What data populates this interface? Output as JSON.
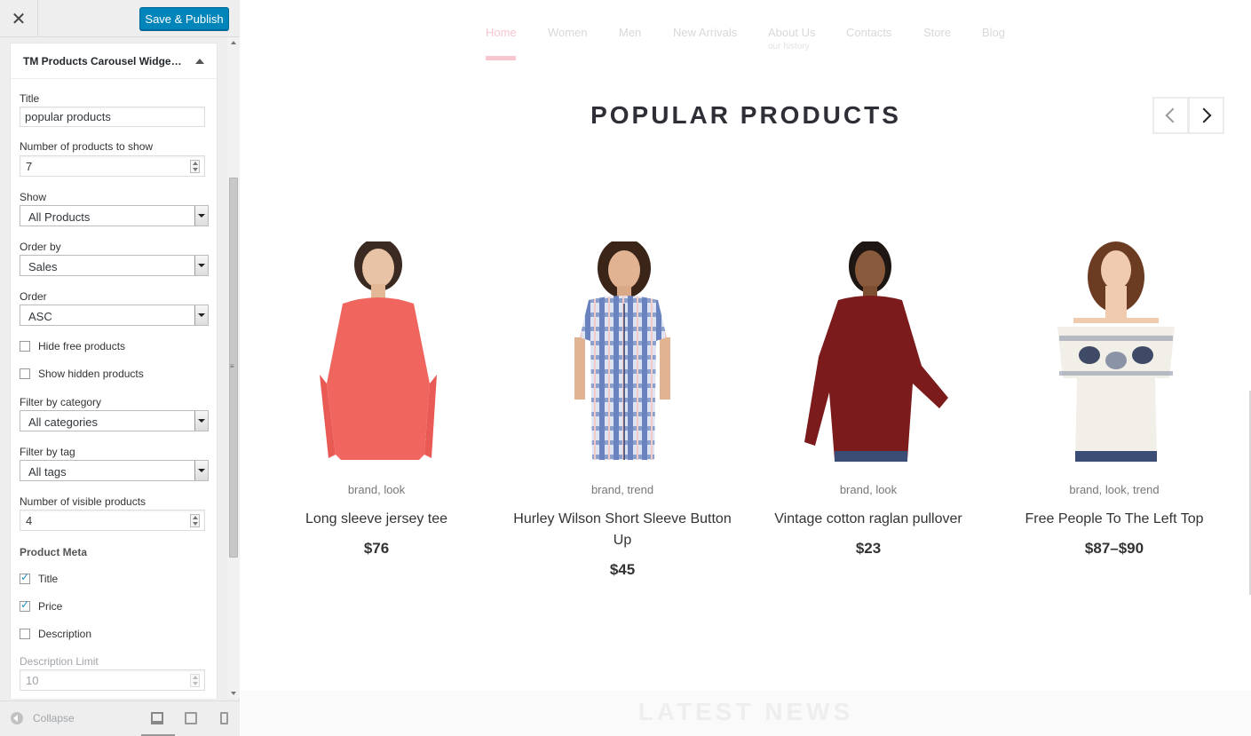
{
  "header": {
    "close_icon": "close-icon",
    "publish_label": "Save & Publish"
  },
  "widget": {
    "title": "TM Products Carousel Widge…",
    "title_label": "Title",
    "title_value": "popular products",
    "num_label": "Number of products to show",
    "num_value": "7",
    "show_label": "Show",
    "show_value": "All Products",
    "orderby_label": "Order by",
    "orderby_value": "Sales",
    "order_label": "Order",
    "order_value": "ASC",
    "hide_free_label": "Hide free products",
    "hide_free_checked": false,
    "show_hidden_label": "Show hidden products",
    "show_hidden_checked": false,
    "cat_label": "Filter by category",
    "cat_value": "All categories",
    "tag_label": "Filter by tag",
    "tag_value": "All tags",
    "visible_label": "Number of visible products",
    "visible_value": "4",
    "meta_label": "Product Meta",
    "meta_title_label": "Title",
    "meta_title_checked": true,
    "meta_price_label": "Price",
    "meta_price_checked": true,
    "meta_desc_label": "Description",
    "meta_desc_checked": false,
    "desc_limit_label": "Description Limit",
    "desc_limit_value": "10"
  },
  "footer": {
    "collapse_label": "Collapse"
  },
  "nav": {
    "items": [
      {
        "label": "Home",
        "active": true
      },
      {
        "label": "Women"
      },
      {
        "label": "Men"
      },
      {
        "label": "New Arrivals"
      },
      {
        "label": "About Us",
        "sub": "our history"
      },
      {
        "label": "Contacts"
      },
      {
        "label": "Store"
      },
      {
        "label": "Blog"
      }
    ]
  },
  "section": {
    "heading": "POPULAR PRODUCTS"
  },
  "products": [
    {
      "tags": [
        "brand",
        "look"
      ],
      "name": "Long sleeve jersey tee",
      "price": "$76",
      "color": "#f0665e"
    },
    {
      "tags": [
        "brand",
        "trend"
      ],
      "name": "Hurley Wilson Short Sleeve Button Up",
      "price": "$45",
      "color": "#7e95c6"
    },
    {
      "tags": [
        "brand",
        "look"
      ],
      "name": "Vintage cotton raglan pullover",
      "price": "$23",
      "color": "#7b1b1c"
    },
    {
      "tags": [
        "brand",
        "look",
        "trend"
      ],
      "name": "Free People To The Left Top",
      "price": "$87–$90",
      "color": "#f2efe8"
    }
  ],
  "latest": {
    "heading": "LATEST NEWS"
  }
}
